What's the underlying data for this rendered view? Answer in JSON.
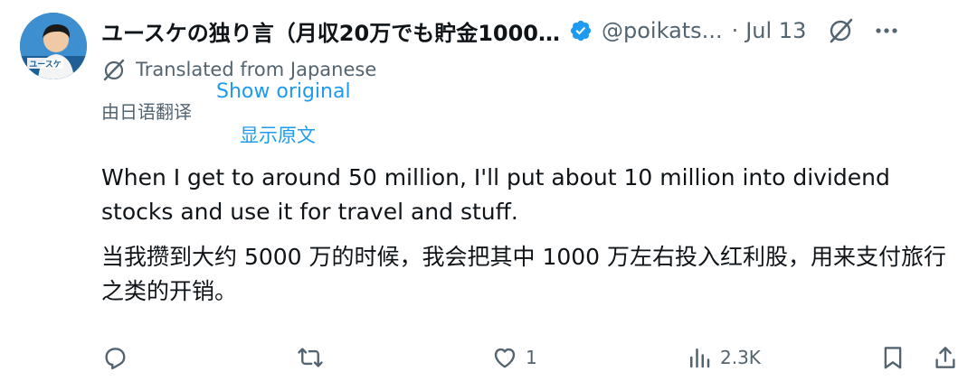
{
  "author": {
    "display_name": "ユースケの独り言（月収20万でも貯金1000…",
    "handle": "@poikats...",
    "separator": "·",
    "date": "Jul 13",
    "avatar_label": "ユースケ",
    "verified_color": "#1d9bf0"
  },
  "translation": {
    "translated_from": "Translated from Japanese",
    "show_original": "Show original",
    "zh_translated": "由日语翻译",
    "zh_show_original": "显示原文"
  },
  "tweet": {
    "text_en": "When I get to around 50 million, I'll put about 10 million into dividend stocks and use it for travel and stuff.",
    "text_zh": "当我攒到大约 5000 万的时候，我会把其中 1000 万左右投入红利股，用来支付旅行之类的开销。"
  },
  "actions": {
    "reply_count": "",
    "retweet_count": "",
    "like_count": "1",
    "views_count": "2.3K"
  },
  "colors": {
    "text_primary": "#0f1419",
    "text_secondary": "#536471",
    "link": "#1d9bf0"
  },
  "icons": [
    "verified-badge-icon",
    "grok-icon",
    "more-icon",
    "translate-icon",
    "reply-icon",
    "retweet-icon",
    "like-icon",
    "views-icon",
    "bookmark-icon",
    "share-icon"
  ]
}
